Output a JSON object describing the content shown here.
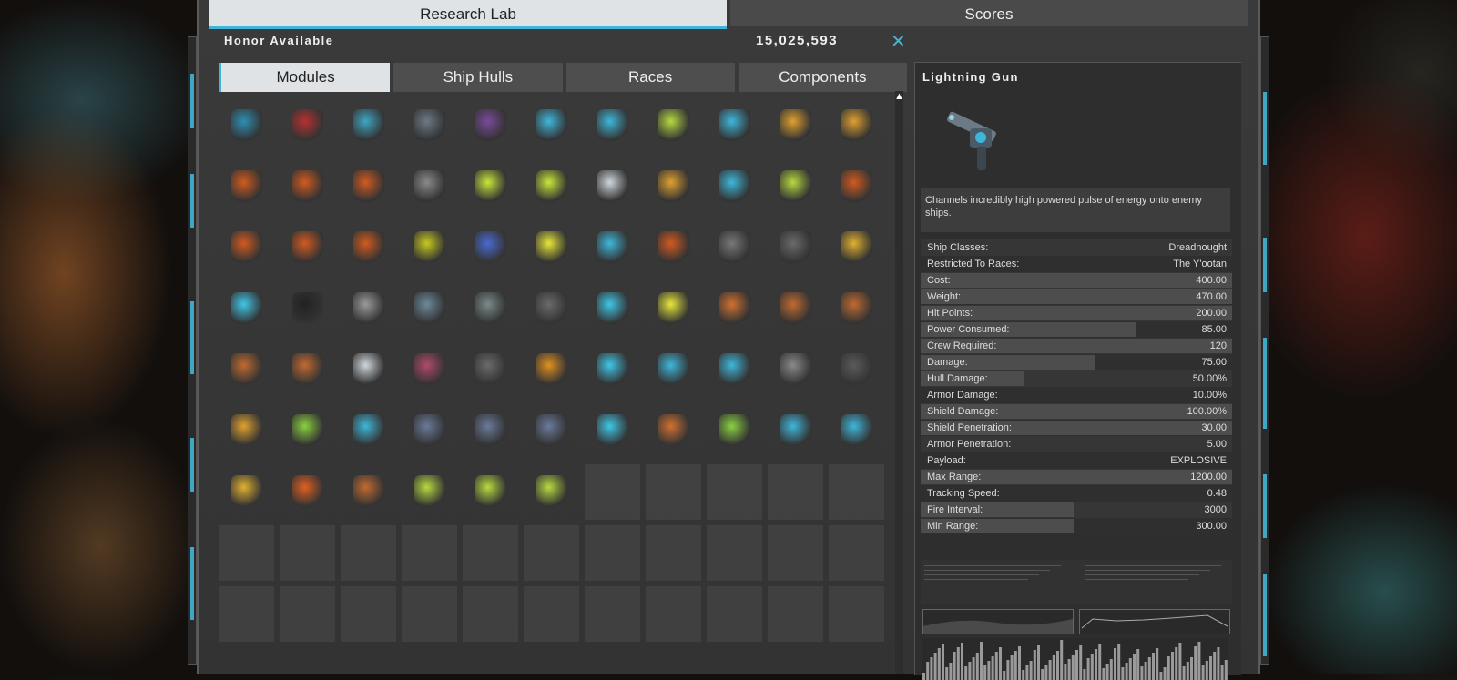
{
  "top_tabs": [
    {
      "label": "Research Lab",
      "active": true
    },
    {
      "label": "Scores",
      "active": false
    }
  ],
  "honor": {
    "label": "Honor Available",
    "value": "15,025,593"
  },
  "sub_tabs": [
    {
      "label": "Modules",
      "active": true
    },
    {
      "label": "Ship Hulls",
      "active": false
    },
    {
      "label": "Races",
      "active": false
    },
    {
      "label": "Components",
      "active": false
    }
  ],
  "module_rows": [
    [
      "#2d8fb3",
      "#b53030",
      "#3fa6c4",
      "#6c7a85",
      "#7a4a9a",
      "#3fb6d9",
      "#3fb6d9",
      "#b7d93f",
      "#3fb6d9",
      "#e0a030",
      "#e0a030"
    ],
    [
      "#d05a20",
      "#d05a20",
      "#d05a20",
      "#8a8a8a",
      "#c8e63a",
      "#c8e63a",
      "#cfd6da",
      "#e0a030",
      "#3fb6d9",
      "#b7d93f",
      "#d05a20"
    ],
    [
      "#d05a20",
      "#d05a20",
      "#d05a20",
      "#c8c820",
      "#4a6ad0",
      "#e6e63a",
      "#3fb6d9",
      "#d05a20",
      "#777777",
      "#6a6a6a",
      "#e0b030"
    ],
    [
      "#3fc6e6",
      "#222222",
      "#9a9a9a",
      "#6c8a9a",
      "#7a8a8a",
      "#6a6a6a",
      "#3fc6e6",
      "#e6e63a",
      "#d07030",
      "#c06a30",
      "#c06a30"
    ],
    [
      "#c06a30",
      "#c06a30",
      "#cfd6da",
      "#b04a6a",
      "#6a6a6a",
      "#e09020",
      "#3fc6e6",
      "#3fb6d9",
      "#3fb6d9",
      "#8a8a8a",
      "#5a5a5a"
    ],
    [
      "#e0a030",
      "#8ad040",
      "#3fb6d9",
      "#6a7a9a",
      "#6a7a9a",
      "#6a7a9a",
      "#3fc6e6",
      "#d07030",
      "#8ad040",
      "#3fb6d9",
      "#3fb6d9"
    ],
    [
      "#e0b030",
      "#e06020",
      "#c06a30",
      "#b7d93f",
      "#b7d93f",
      "#b7d93f",
      "",
      "",
      "",
      "",
      ""
    ],
    [
      "",
      "",
      "",
      "",
      "",
      "",
      "",
      "",
      "",
      "",
      ""
    ],
    [
      "",
      "",
      "",
      "",
      "",
      "",
      "",
      "",
      "",
      "",
      ""
    ]
  ],
  "detail": {
    "title": "Lightning Gun",
    "description": "Channels incredibly high powered pulse of energy onto enemy ships.",
    "stats": [
      {
        "label": "Ship Classes:",
        "value": "Dreadnought",
        "fill": 0
      },
      {
        "label": "Restricted To Races:",
        "value": "The Y'ootan",
        "fill": 0
      },
      {
        "label": "Cost:",
        "value": "400.00",
        "fill": 1
      },
      {
        "label": "Weight:",
        "value": "470.00",
        "fill": 1
      },
      {
        "label": "Hit Points:",
        "value": "200.00",
        "fill": 1
      },
      {
        "label": "Power Consumed:",
        "value": "85.00",
        "fill": 0.69
      },
      {
        "label": "Crew Required:",
        "value": "120",
        "fill": 1
      },
      {
        "label": "Damage:",
        "value": "75.00",
        "fill": 0.56
      },
      {
        "label": "Hull Damage:",
        "value": "50.00%",
        "fill": 0.33
      },
      {
        "label": "Armor Damage:",
        "value": "10.00%",
        "fill": 0
      },
      {
        "label": "Shield Damage:",
        "value": "100.00%",
        "fill": 1
      },
      {
        "label": "Shield Penetration:",
        "value": "30.00",
        "fill": 1
      },
      {
        "label": "Armor Penetration:",
        "value": "5.00",
        "fill": 0
      },
      {
        "label": "Payload:",
        "value": "EXPLOSIVE",
        "fill": 0
      },
      {
        "label": "Max Range:",
        "value": "1200.00",
        "fill": 1
      },
      {
        "label": "Tracking Speed:",
        "value": "0.48",
        "fill": 0
      },
      {
        "label": "Fire Interval:",
        "value": "3000",
        "fill": 0.49
      },
      {
        "label": "Min Range:",
        "value": "300.00",
        "fill": 0.49
      }
    ]
  },
  "colors": {
    "accent": "#3fb6d9",
    "panel": "#333333",
    "tab_active": "#dfe3e6"
  }
}
